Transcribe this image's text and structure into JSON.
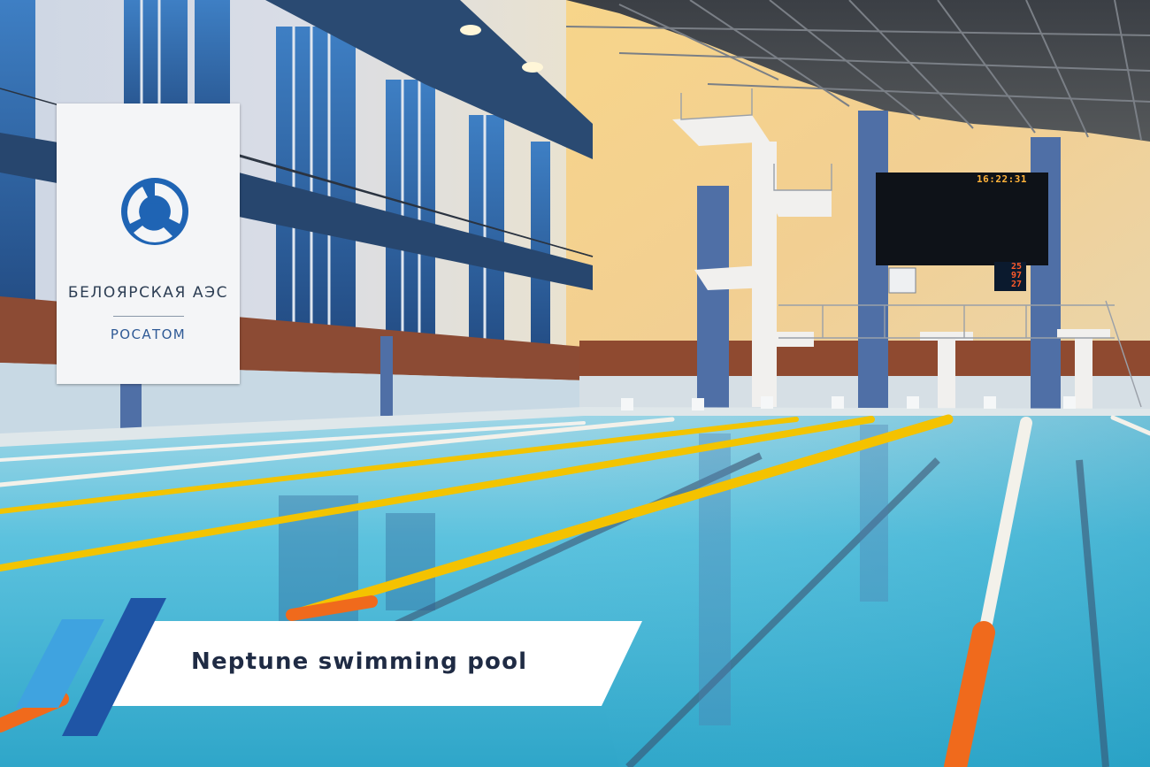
{
  "banner": {
    "plant_name": "БЕЛОЯРСКАЯ АЭС",
    "organization": "РОСАТОМ"
  },
  "scoreboard": {
    "clock": "16:22:31",
    "lane_numbers": [
      "25",
      "97",
      "27"
    ]
  },
  "caption": {
    "text": "Neptune swimming pool"
  },
  "colors": {
    "caption_plate": "#ffffff",
    "caption_text": "#1f2b44",
    "brand_blue": "#1f55a6",
    "brand_light_blue": "#3fa3e0",
    "lane_rope_yellow": "#f2c400",
    "lane_rope_orange": "#f06a1c",
    "pool_water": "#3fb3d6"
  }
}
